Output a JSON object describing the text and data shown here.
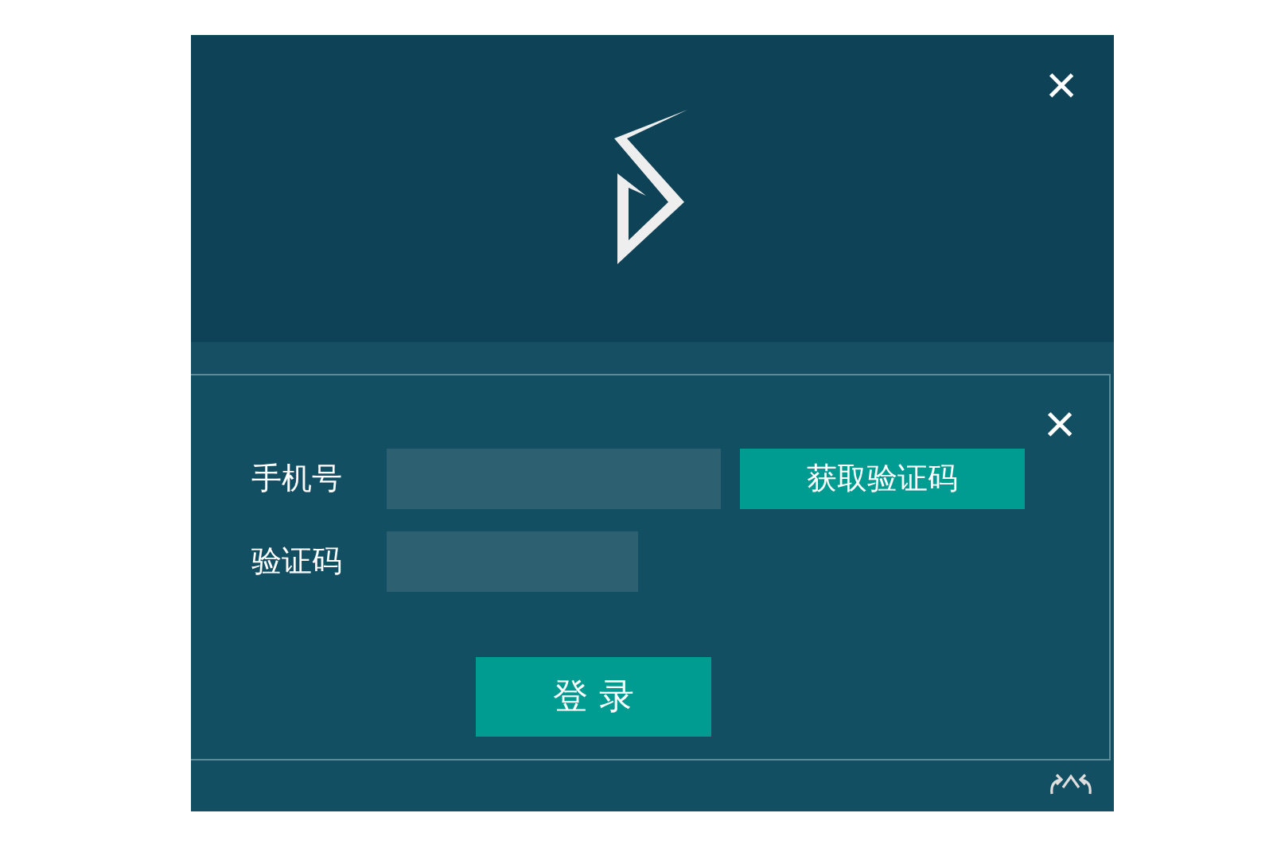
{
  "window": {
    "header": {
      "close": "×"
    },
    "form": {
      "close": "×",
      "rows": [
        {
          "kind": "phone",
          "label": "手机号",
          "button": "获取验证码"
        },
        {
          "kind": "code",
          "label": "验证码"
        }
      ],
      "submit": "登 录"
    }
  }
}
